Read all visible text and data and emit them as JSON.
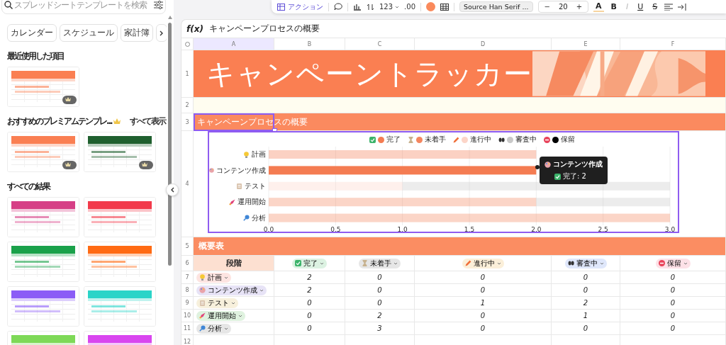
{
  "sidebar": {
    "search": {
      "placeholder": "スプレッドシートテンプレートを検索"
    },
    "categories": [
      "カレンダー",
      "スケジュール",
      "家計簿"
    ],
    "recent": {
      "title": "最近使用した項目",
      "templates": [
        {
          "kind": "picture",
          "color": "#fa7f52",
          "premium": true
        }
      ]
    },
    "featured": {
      "title": "おすすめのプレミアムテンプレ...",
      "link": "すべて表示",
      "templates": [
        {
          "kind": "picture",
          "color": "#fa7f52",
          "premium": true
        },
        {
          "kind": "picture",
          "color": "#1f5f2e",
          "premium": true
        }
      ]
    },
    "results": {
      "title": "すべての結果",
      "templates": [
        {
          "kind": "picture",
          "color": "#d63f86",
          "premium": false
        },
        {
          "kind": "picture",
          "color": "#f23a4b",
          "premium": false
        },
        {
          "kind": "picture",
          "color": "#1aa14a",
          "premium": false
        },
        {
          "kind": "picture",
          "color": "#ff6a13",
          "premium": false
        },
        {
          "kind": "picture",
          "color": "#8b5cf6",
          "premium": false
        },
        {
          "kind": "picture",
          "color": "#2bd4c8",
          "premium": false
        },
        {
          "kind": "picture",
          "color": "#7ed957",
          "premium": false
        },
        {
          "kind": "picture",
          "color": "#d946ef",
          "premium": false
        }
      ]
    }
  },
  "toolbar": {
    "action": "アクション",
    "number_format": "123",
    "decimals": ".00",
    "font": "Source Han Serif ...",
    "decrease": "−",
    "font_size": "20",
    "increase": "+",
    "text_styles": [
      {
        "kind": "color",
        "label": "A"
      },
      {
        "kind": "bold",
        "label": "B"
      },
      {
        "kind": "italic",
        "label": "I"
      },
      {
        "kind": "underline",
        "label": "U"
      },
      {
        "kind": "strike",
        "label": "S"
      }
    ]
  },
  "formula_bar": {
    "label": "f(x)",
    "value": "キャンペーンプロセスの概要"
  },
  "columns": [
    {
      "label": "A",
      "selected": true
    },
    {
      "label": "B",
      "selected": false
    },
    {
      "label": "C",
      "selected": false
    },
    {
      "label": "D",
      "selected": false
    },
    {
      "label": "E",
      "selected": false
    },
    {
      "label": "F",
      "selected": false
    }
  ],
  "row_numbers": [
    "1",
    "2",
    "3",
    "4",
    "5",
    "6",
    "7",
    "8",
    "9",
    "10",
    "11",
    "12"
  ],
  "title": "キャンペーントラッカー",
  "process_section": {
    "title": "キャンペーンプロセスの概要",
    "selected": true
  },
  "chart": {
    "selected": true,
    "chart_data": {
      "type": "bar",
      "orientation": "horizontal",
      "stacked": true,
      "grid": true,
      "legend": "top",
      "categories": [
        "計画",
        "コンテンツ作成",
        "テスト",
        "運用開始",
        "分析"
      ],
      "series": [
        {
          "name": "完了",
          "color": "#f47c52",
          "values": [
            2,
            2,
            0,
            0,
            0
          ]
        },
        {
          "name": "未着手",
          "color": "#f4865f",
          "values": [
            0,
            0,
            0,
            2,
            3
          ]
        },
        {
          "name": "進行中",
          "color": "#fcd5c8",
          "values": [
            0,
            0,
            1,
            0,
            0
          ]
        },
        {
          "name": "審査中",
          "color": "#c8c8c8",
          "values": [
            0,
            0,
            2,
            1,
            0
          ]
        },
        {
          "name": "保留",
          "color": "#000000",
          "values": [
            0,
            0,
            0,
            0,
            0
          ]
        }
      ],
      "xlim": [
        0,
        3
      ],
      "xticks": [
        {
          "value": 0,
          "label": "0.0"
        },
        {
          "value": 0.5,
          "label": "0.5"
        },
        {
          "value": 1,
          "label": "1.0"
        },
        {
          "value": 1.5,
          "label": "1.5"
        },
        {
          "value": 2,
          "label": "2.0"
        },
        {
          "value": 2.5,
          "label": "2.5"
        },
        {
          "value": 3,
          "label": "3.0"
        }
      ]
    },
    "category_states": [
      {
        "selected": false
      },
      {
        "selected": true
      },
      {
        "selected": false
      },
      {
        "selected": false
      },
      {
        "selected": false
      }
    ],
    "tooltip": {
      "title": "コンテンツ作成",
      "text": "完了: 2"
    }
  },
  "summary_section": {
    "title": "概要表"
  },
  "summary_table": {
    "stage_header": "段階",
    "statuses": [
      {
        "label": "完了",
        "color": "#dcf2e2"
      },
      {
        "label": "未着手",
        "color": "#e6e6e6"
      },
      {
        "label": "進行中",
        "color": "#fbefd9"
      },
      {
        "label": "審査中",
        "color": "#dfe7fb"
      },
      {
        "label": "保留",
        "color": "#fde1e7"
      }
    ],
    "rows": [
      {
        "stage": "計画",
        "color": "#fde4e1",
        "values": [
          "2",
          "0",
          "0",
          "0",
          "0"
        ]
      },
      {
        "stage": "コンテンツ作成",
        "color": "#e7e3f6",
        "values": [
          "2",
          "0",
          "0",
          "0",
          "0"
        ]
      },
      {
        "stage": "テスト",
        "color": "#f7f0dc",
        "values": [
          "0",
          "0",
          "1",
          "2",
          "0"
        ]
      },
      {
        "stage": "運用開始",
        "color": "#dff2df",
        "values": [
          "0",
          "2",
          "0",
          "1",
          "0"
        ]
      },
      {
        "stage": "分析",
        "color": "#e6e6e6",
        "values": [
          "0",
          "3",
          "0",
          "0",
          "0"
        ]
      }
    ]
  }
}
